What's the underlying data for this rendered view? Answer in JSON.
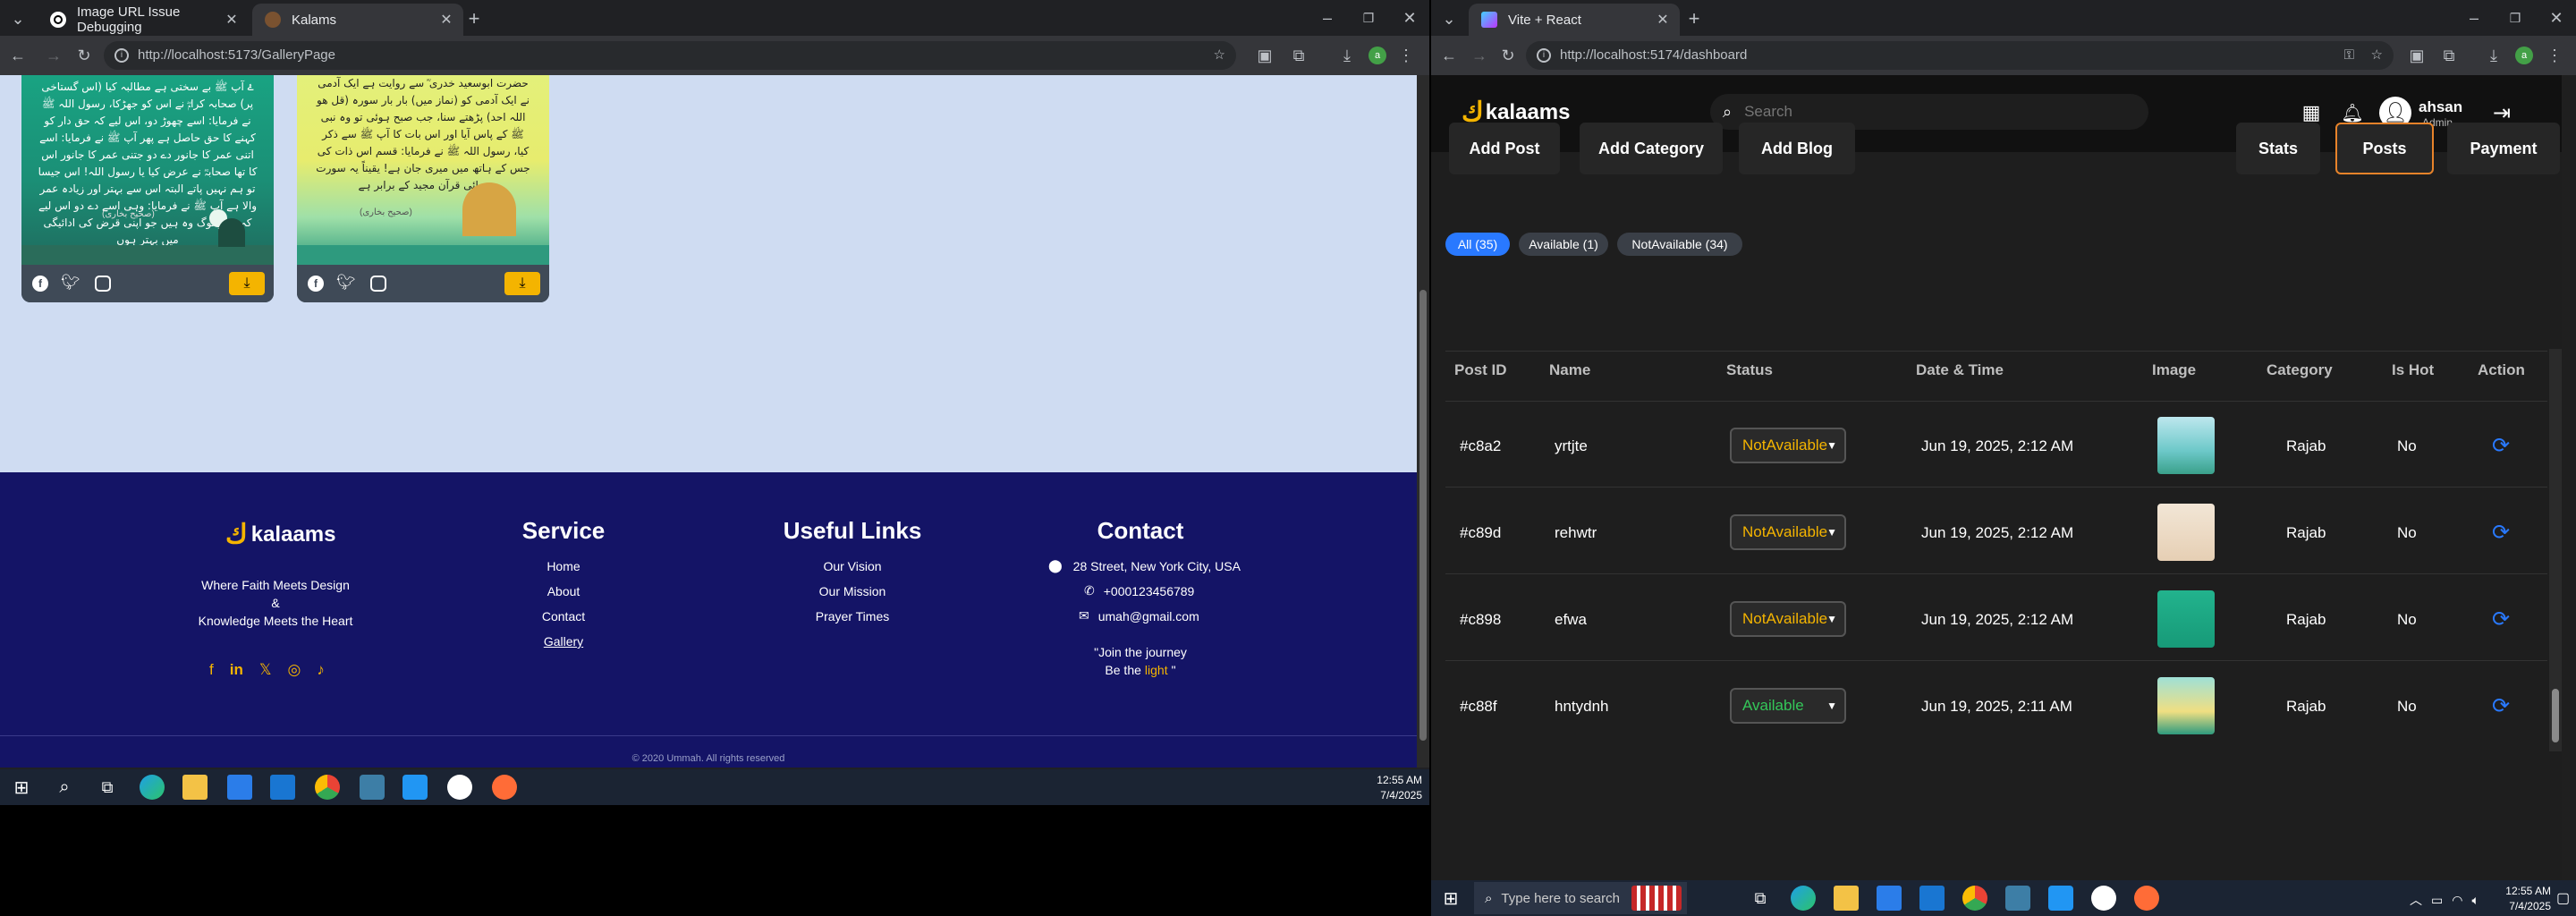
{
  "left_browser": {
    "tabs": [
      {
        "title": "Image URL Issue Debugging"
      },
      {
        "title": "Kalams"
      }
    ],
    "url": "http://localhost:5173/GalleryPage"
  },
  "gallery": {
    "cards": [
      {
        "text": "ۓ آپ ﷺ بے سختی ہے مطالبہ کیا (اس گستاخی پر) صحابہ کرامؓ نے اس کو جھڑکا، رسول اللہ ﷺ نے فرمایا: اسے چھوڑ دو، اس لیے کہ حق دار کو کہنے کا حق حاصل ہے پھر آپ ﷺ نے فرمایا: اسے اتنی عمر کا جانور دے دو جتنی عمر کا جانور اس کا تھا صحابہؓ نے عرض کیا یا رسول اللہ! اس جیسا تو ہم نہیں پاتے البتہ اس سے بہتر اور زیادہ عمر والا ہے آپ ﷺ نے فرمایا: وہی اسے دے دو اس لیے کہ بہتر لوگ وہ ہیں جو اپنی قرض کی ادائیگی میں بہتر ہوں",
        "ref": "(صحیح بخاری)"
      },
      {
        "text": "حضرت ابوسعید خدری ؓ سے روایت ہے ایک آدمی نے ایک آدمی کو (نماز میں) بار بار سورہ (قل ھو اللہ احد) پڑھتے سنا، جب صبح ہوئی تو وہ نبی ﷺ کے پاس آیا اور اس بات کا آپ ﷺ سے ذکر کیا، رسول اللہ ﷺ نے فرمایا: قسم اس ذات کی جس کے ہاتھ میں میری جان ہے! یقیناً یہ سورت تہائی قرآن مجید کے برابر ہے",
        "ref": "(صحیح بخاری)"
      }
    ]
  },
  "footer": {
    "logo_text": "kalaams",
    "tagline": [
      "Where Faith Meets Design",
      "&",
      "Knowledge Meets the Heart"
    ],
    "service": {
      "heading": "Service",
      "links": [
        "Home",
        "About",
        "Contact",
        "Gallery"
      ]
    },
    "useful": {
      "heading": "Useful Links",
      "links": [
        "Our Vision",
        "Our Mission",
        "Prayer Times"
      ]
    },
    "contact": {
      "heading": "Contact",
      "address": "28 Street, New York City, USA",
      "phone": "+000123456789",
      "email": "umah@gmail.com",
      "quote_line1": "\"Join the journey",
      "quote_line2a": "Be the",
      "quote_highlight": "light",
      "quote_line2b": "\""
    },
    "copyright": "© 2020 Ummah. All rights reserved"
  },
  "left_taskbar": {
    "time": "12:55 AM",
    "date": "7/4/2025"
  },
  "right_browser": {
    "tabs": [
      {
        "title": "Vite + React"
      }
    ],
    "url": "http://localhost:5174/dashboard"
  },
  "dashboard": {
    "logo_text": "kalaams",
    "search_placeholder": "Search",
    "user_name": "ahsan",
    "user_role": "Admin",
    "left_actions": [
      "Add Post",
      "Add Category",
      "Add Blog"
    ],
    "right_actions": [
      "Stats",
      "Posts",
      "Payment"
    ],
    "filters": [
      "All (35)",
      "Available (1)",
      "NotAvailable (34)"
    ],
    "columns": [
      "Post ID",
      "Name",
      "Status",
      "Date & Time",
      "Image",
      "Category",
      "Is Hot",
      "Action"
    ],
    "rows": [
      {
        "id": "#c8a2",
        "name": "yrtjte",
        "status": "NotAvailable",
        "date": "Jun 19, 2025, 2:12 AM",
        "category": "Rajab",
        "hot": "No"
      },
      {
        "id": "#c89d",
        "name": "rehwtr",
        "status": "NotAvailable",
        "date": "Jun 19, 2025, 2:12 AM",
        "category": "Rajab",
        "hot": "No"
      },
      {
        "id": "#c898",
        "name": "efwa",
        "status": "NotAvailable",
        "date": "Jun 19, 2025, 2:12 AM",
        "category": "Rajab",
        "hot": "No"
      },
      {
        "id": "#c88f",
        "name": "hntydnh",
        "status": "Available",
        "date": "Jun 19, 2025, 2:11 AM",
        "category": "Rajab",
        "hot": "No"
      }
    ]
  },
  "right_taskbar": {
    "search_placeholder": "Type here to search",
    "time": "12:55 AM",
    "date": "7/4/2025"
  },
  "colors": {
    "footer_bg": "#141466",
    "gallery_bg": "#cfdcf2",
    "gold": "#f4b400",
    "accent_orange": "#e8832a",
    "filter_blue": "#2979ff",
    "refresh_blue": "#2979ff"
  }
}
